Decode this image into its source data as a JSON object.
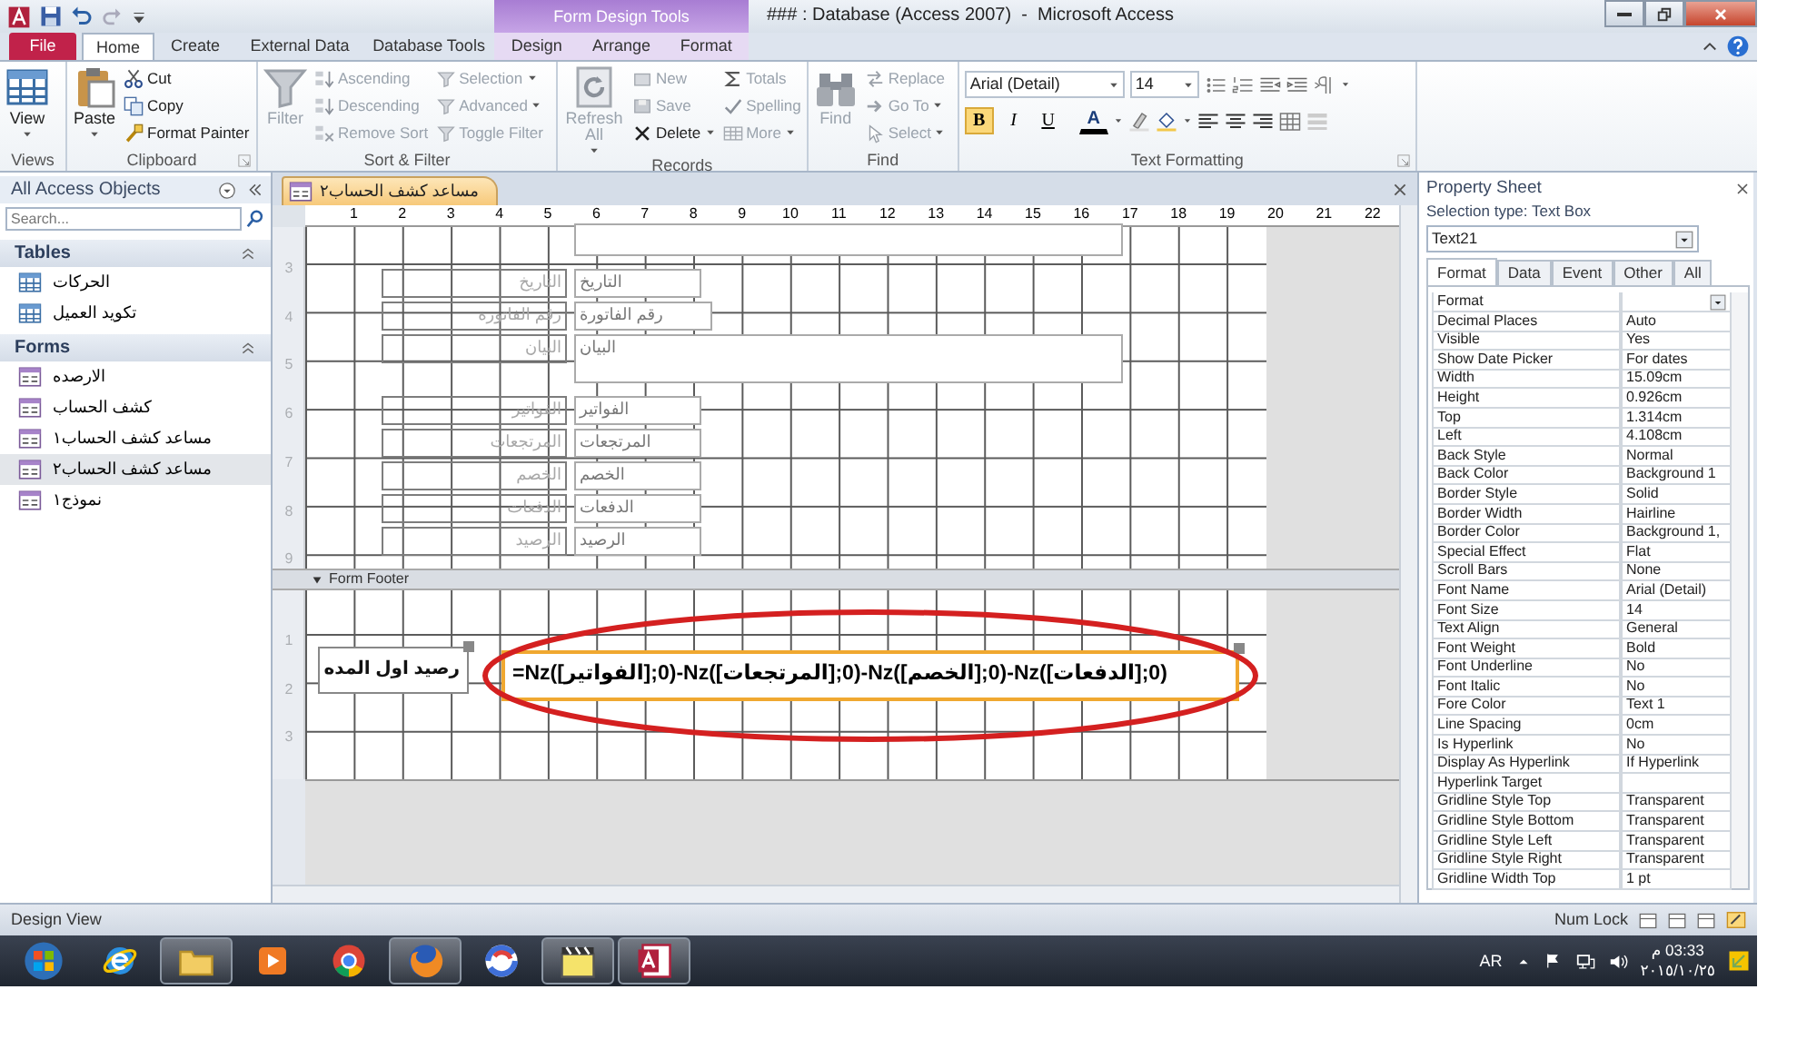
{
  "title_bar": {
    "title": "### : Database (Access 2007)  -  Microsoft Access",
    "context_group": "Form Design Tools"
  },
  "ribbon_tabs": [
    {
      "label": "File",
      "kind": "file",
      "selected": false
    },
    {
      "label": "Home",
      "kind": "standard",
      "selected": true
    },
    {
      "label": "Create",
      "kind": "standard",
      "selected": false
    },
    {
      "label": "External Data",
      "kind": "standard",
      "selected": false
    },
    {
      "label": "Database Tools",
      "kind": "standard",
      "selected": false
    },
    {
      "label": "Design",
      "kind": "contextual",
      "selected": false
    },
    {
      "label": "Arrange",
      "kind": "contextual",
      "selected": false
    },
    {
      "label": "Format",
      "kind": "contextual",
      "selected": false
    }
  ],
  "ribbon_groups": [
    {
      "label": "Views",
      "items": [
        {
          "label": "View",
          "kind": "large",
          "dropdown": true,
          "disabled": false
        }
      ]
    },
    {
      "label": "Clipboard",
      "launcher": true,
      "items": [
        {
          "label": "Paste",
          "kind": "large",
          "dropdown": true,
          "disabled": false
        },
        {
          "label": "Cut",
          "kind": "small",
          "dropdown": false,
          "disabled": false
        },
        {
          "label": "Copy",
          "kind": "small",
          "dropdown": false,
          "disabled": false
        },
        {
          "label": "Format Painter",
          "kind": "small",
          "dropdown": false,
          "disabled": false
        }
      ]
    },
    {
      "label": "Sort & Filter",
      "items": [
        {
          "label": "Filter",
          "kind": "large",
          "dropdown": false,
          "disabled": true
        },
        {
          "label": "Ascending",
          "kind": "small",
          "dropdown": false,
          "disabled": true
        },
        {
          "label": "Descending",
          "kind": "small",
          "dropdown": false,
          "disabled": true
        },
        {
          "label": "Remove Sort",
          "kind": "small",
          "dropdown": false,
          "disabled": true
        },
        {
          "label": "Selection",
          "kind": "small",
          "dropdown": true,
          "disabled": true
        },
        {
          "label": "Advanced",
          "kind": "small",
          "dropdown": true,
          "disabled": true
        },
        {
          "label": "Toggle Filter",
          "kind": "small",
          "dropdown": false,
          "disabled": true
        }
      ]
    },
    {
      "label": "Records",
      "items": [
        {
          "label": "Refresh All",
          "kind": "large",
          "dropdown": true,
          "disabled": true
        },
        {
          "label": "New",
          "kind": "small",
          "dropdown": false,
          "disabled": true
        },
        {
          "label": "Save",
          "kind": "small",
          "dropdown": false,
          "disabled": true
        },
        {
          "label": "Delete",
          "kind": "small",
          "dropdown": true,
          "disabled": false
        },
        {
          "label": "Totals",
          "kind": "small",
          "dropdown": false,
          "disabled": true
        },
        {
          "label": "Spelling",
          "kind": "small",
          "dropdown": false,
          "disabled": true
        },
        {
          "label": "More",
          "kind": "small",
          "dropdown": true,
          "disabled": true
        }
      ]
    },
    {
      "label": "Find",
      "items": [
        {
          "label": "Find",
          "kind": "large",
          "dropdown": false,
          "disabled": true
        },
        {
          "label": "Replace",
          "kind": "small",
          "dropdown": false,
          "disabled": true
        },
        {
          "label": "Go To",
          "kind": "small",
          "dropdown": true,
          "disabled": true
        },
        {
          "label": "Select",
          "kind": "small",
          "dropdown": true,
          "disabled": true
        }
      ]
    }
  ],
  "text_formatting": {
    "label": "Text Formatting",
    "launcher": true,
    "font": "Arial (Detail)",
    "size": "14",
    "font_color": "A",
    "styles": [
      {
        "label": "B",
        "selected": true
      },
      {
        "label": "I",
        "selected": false
      },
      {
        "label": "U",
        "selected": false
      }
    ]
  },
  "navigation_pane": {
    "title": "All Access Objects",
    "search_placeholder": "Search...",
    "groups": [
      {
        "label": "Tables",
        "kind": "table",
        "items": [
          {
            "label": "الحركات",
            "selected": false
          },
          {
            "label": "تكويد العميل",
            "selected": false
          }
        ]
      },
      {
        "label": "Forms",
        "kind": "form",
        "items": [
          {
            "label": "الارصده",
            "selected": false
          },
          {
            "label": "كشف الحساب",
            "selected": false
          },
          {
            "label": "مساعد كشف الحساب١",
            "selected": false
          },
          {
            "label": "مساعد كشف الحساب٢",
            "selected": true
          },
          {
            "label": "نموذج١",
            "selected": false
          }
        ]
      }
    ]
  },
  "document_tab": {
    "label": "مساعد كشف الحساب٢"
  },
  "design_view": {
    "ruler_horizontal": [
      "1",
      "2",
      "3",
      "4",
      "5",
      "6",
      "7",
      "8",
      "9",
      "10",
      "11",
      "12",
      "13",
      "14",
      "15",
      "16",
      "17",
      "18",
      "19",
      "20",
      "21",
      "22"
    ],
    "ruler_detail": [
      "3",
      "4",
      "5",
      "6",
      "7",
      "8",
      "9"
    ],
    "ruler_footer": [
      "1",
      "2",
      "3"
    ],
    "detail_controls": [
      {
        "label": "التاريخ",
        "field": "التاريخ",
        "kind": "short"
      },
      {
        "label": "رقم الفاتورة",
        "field": "رقم الفاتورة",
        "kind": "medium"
      },
      {
        "label": "البيان",
        "field": "البيان",
        "kind": "memo"
      },
      {
        "label": "الفواتير",
        "field": "الفواتير",
        "kind": "short"
      },
      {
        "label": "المرتجعات",
        "field": "المرتجعات",
        "kind": "short"
      },
      {
        "label": "الخصم",
        "field": "الخصم",
        "kind": "short"
      },
      {
        "label": "الدفعات",
        "field": "الدفعات",
        "kind": "short"
      },
      {
        "label": "الرصيد",
        "field": "الرصيد",
        "kind": "short"
      }
    ],
    "footer_title": "Form Footer",
    "footer_label": "رصيد اول المده",
    "footer_textbox": {
      "value": "=Nz([الفواتير];0)-Nz([المرتجعات];0)-Nz([الخصم];0)-Nz([الدفعات];0)",
      "selected": true
    }
  },
  "property_sheet": {
    "title": "Property Sheet",
    "selection_type": "Selection type:  Text Box",
    "selected_control": "Text21",
    "tabs": [
      {
        "label": "Format",
        "selected": true
      },
      {
        "label": "Data",
        "selected": false
      },
      {
        "label": "Event",
        "selected": false
      },
      {
        "label": "Other",
        "selected": false
      },
      {
        "label": "All",
        "selected": false
      }
    ],
    "properties": [
      {
        "name": "Format",
        "dropdown": true
      },
      {
        "name": "Decimal Places",
        "value": "Auto"
      },
      {
        "name": "Visible",
        "value": "Yes"
      },
      {
        "name": "Show Date Picker",
        "value": "For dates"
      },
      {
        "name": "Width",
        "value": "15.09cm"
      },
      {
        "name": "Height",
        "value": "0.926cm"
      },
      {
        "name": "Top",
        "value": "1.314cm"
      },
      {
        "name": "Left",
        "value": "4.108cm"
      },
      {
        "name": "Back Style",
        "value": "Normal"
      },
      {
        "name": "Back Color",
        "value": "Background 1"
      },
      {
        "name": "Border Style",
        "value": "Solid"
      },
      {
        "name": "Border Width",
        "value": "Hairline"
      },
      {
        "name": "Border Color",
        "value": "Background 1,"
      },
      {
        "name": "Special Effect",
        "value": "Flat"
      },
      {
        "name": "Scroll Bars",
        "value": "None"
      },
      {
        "name": "Font Name",
        "value": "Arial (Detail)"
      },
      {
        "name": "Font Size",
        "value": "14"
      },
      {
        "name": "Text Align",
        "value": "General"
      },
      {
        "name": "Font Weight",
        "value": "Bold"
      },
      {
        "name": "Font Underline",
        "value": "No"
      },
      {
        "name": "Font Italic",
        "value": "No"
      },
      {
        "name": "Fore Color",
        "value": "Text 1"
      },
      {
        "name": "Line Spacing",
        "value": "0cm"
      },
      {
        "name": "Is Hyperlink",
        "value": "No"
      },
      {
        "name": "Display As Hyperlink",
        "value": "If Hyperlink"
      },
      {
        "name": "Hyperlink Target"
      },
      {
        "name": "Gridline Style Top",
        "value": "Transparent"
      },
      {
        "name": "Gridline Style Bottom",
        "value": "Transparent"
      },
      {
        "name": "Gridline Style Left",
        "value": "Transparent"
      },
      {
        "name": "Gridline Style Right",
        "value": "Transparent"
      },
      {
        "name": "Gridline Width Top",
        "value": "1 pt"
      }
    ]
  },
  "status_bar": {
    "left": "Design View",
    "right": "Num Lock"
  },
  "taskbar": {
    "apps": [
      {
        "running": false
      },
      {
        "running": true
      },
      {
        "running": false
      },
      {
        "running": false
      },
      {
        "running": true
      },
      {
        "running": false
      },
      {
        "running": true
      },
      {
        "running": true
      }
    ],
    "language": "AR",
    "time": "03:33 م",
    "date": "٢٠١٥/١٠/٢٥"
  }
}
